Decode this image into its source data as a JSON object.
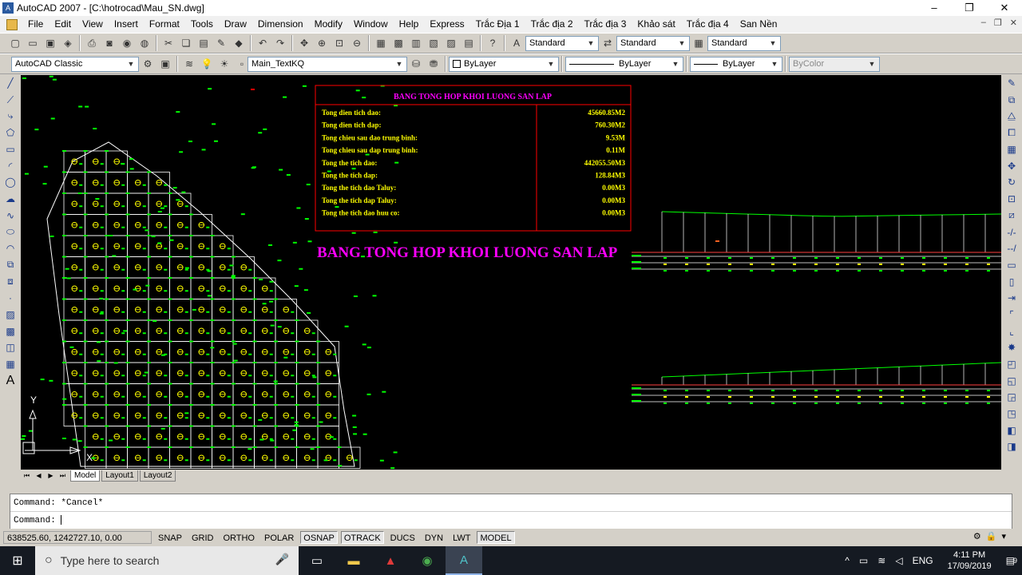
{
  "window": {
    "title": "AutoCAD 2007 - [C:\\hotrocad\\Mau_SN.dwg]",
    "minimize": "–",
    "restore": "❐",
    "close": "✕"
  },
  "menubar": {
    "items": [
      "File",
      "Edit",
      "View",
      "Insert",
      "Format",
      "Tools",
      "Draw",
      "Dimension",
      "Modify",
      "Window",
      "Help",
      "Express",
      "Trắc Địa 1",
      "Trắc địa 2",
      "Trắc địa 3",
      "Khảo sát",
      "Trắc địa 4",
      "San Nền"
    ],
    "mdi_min": "–",
    "mdi_restore": "❐",
    "mdi_close": "✕"
  },
  "toolbar1": {
    "text_style": "Standard",
    "dim_style": "Standard",
    "table_style": "Standard"
  },
  "toolbar2": {
    "workspace": "AutoCAD Classic",
    "layer": "Main_TextKQ",
    "color": "ByLayer",
    "linetype": "ByLayer",
    "lineweight": "ByLayer",
    "plotstyle": "ByColor"
  },
  "drawing": {
    "table_title": "BANG TONG HOP KHOI LUONG SAN LAP",
    "table_rows": [
      {
        "label": "Tong dien tich dao:",
        "value": "45660.85M2"
      },
      {
        "label": "Tong dien tich dap:",
        "value": "760.30M2"
      },
      {
        "label": "Tong chieu sau dao trung binh:",
        "value": "9.53M"
      },
      {
        "label": "Tong chieu sau dap trung binh:",
        "value": "0.11M"
      },
      {
        "label": "Tong the tich dao:",
        "value": "442055.50M3"
      },
      {
        "label": "Tong the tich dap:",
        "value": "128.84M3"
      },
      {
        "label": "Tong the tich dao Taluy:",
        "value": "0.00M3"
      },
      {
        "label": "Tong the tich dap Taluy:",
        "value": "0.00M3"
      },
      {
        "label": "Tong the tich dao huu co:",
        "value": "0.00M3"
      }
    ],
    "big_title": "BANG TONG HOP KHOI LUONG SAN LAP",
    "ucs_y": "Y",
    "ucs_x": "X",
    "colors": {
      "table_border": "#ff0000",
      "table_title": "#ff00ff",
      "table_text": "#ffff00",
      "grid_lines": "#ffffff",
      "points": "#00ff00",
      "big_title": "#ff00ff"
    }
  },
  "tabs": {
    "items": [
      "Model",
      "Layout1",
      "Layout2"
    ],
    "first": "⏮",
    "prev": "◀",
    "next": "▶",
    "last": "⏭"
  },
  "command": {
    "history": "Command: *Cancel*",
    "prompt": "Command: "
  },
  "status": {
    "coords": "638525.60, 1242727.10, 0.00",
    "modes": [
      {
        "label": "SNAP",
        "on": false
      },
      {
        "label": "GRID",
        "on": false
      },
      {
        "label": "ORTHO",
        "on": false
      },
      {
        "label": "POLAR",
        "on": false
      },
      {
        "label": "OSNAP",
        "on": true
      },
      {
        "label": "OTRACK",
        "on": true
      },
      {
        "label": "DUCS",
        "on": false
      },
      {
        "label": "DYN",
        "on": false
      },
      {
        "label": "LWT",
        "on": false
      },
      {
        "label": "MODEL",
        "on": true
      }
    ]
  },
  "taskbar": {
    "search_placeholder": "Type here to search",
    "time": "4:11 PM",
    "date": "17/09/2019",
    "lang": "ENG",
    "notification_count": "9"
  }
}
